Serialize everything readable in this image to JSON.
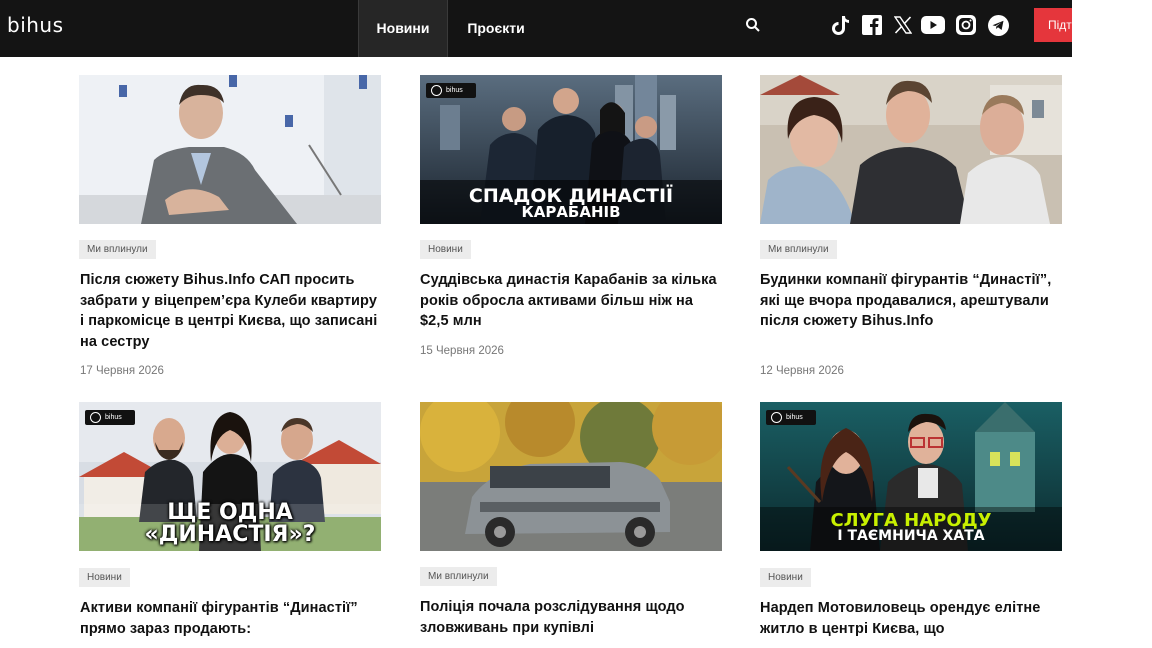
{
  "header": {
    "logo": "bihus",
    "nav": [
      {
        "label": "Новини"
      },
      {
        "label": "Проєкти"
      }
    ],
    "subscribe_label": "Підтримати",
    "social_icons": [
      "tiktok-icon",
      "facebook-icon",
      "x-icon",
      "youtube-icon",
      "instagram-icon",
      "telegram-icon"
    ]
  },
  "colors": {
    "header_bg": "#141414",
    "accent": "#e5363c",
    "tag_bg": "#ececec"
  },
  "articles": [
    {
      "tag": "Ми вплинули",
      "title": "Після сюжету Bihus.Info САП просить забрати у віцепрем’єра Кулеби квартиру і паркомісце в центрі Києва, що записані на сестру",
      "date": "17 Червня 2026"
    },
    {
      "tag": "Новини",
      "title": "Суддівська династія Карабанів за кілька років обросла активами більш ніж на $2,5 млн",
      "date": "15 Червня 2026",
      "image_badge": "bihus",
      "image_caption_1": "СПАДОК ДИНАСТІЇ",
      "image_caption_2": "КАРАБАНІВ"
    },
    {
      "tag": "Ми вплинули",
      "title": "Будинки компанії фігурантів “Династії”, які ще вчора продавалися, арештували після сюжету Bihus.Info",
      "date": "12 Червня 2026"
    },
    {
      "tag": "Новини",
      "title": "Активи компанії фігурантів “Династії” прямо зараз продають:",
      "image_badge": "bihus",
      "image_caption_1": "ЩЕ ОДНА",
      "image_caption_2": "«ДИНАСТІЯ»?"
    },
    {
      "tag": "Ми вплинули",
      "title": "Поліція почала розслідування щодо зловживань при купівлі"
    },
    {
      "tag": "Новини",
      "title": "Нардеп Мотовиловець орендує елітне житло в центрі Києва, що",
      "image_badge": "bihus",
      "image_caption_1": "СЛУГА НАРОДУ",
      "image_caption_2": "І ТАЄМНИЧА ХАТА"
    }
  ]
}
